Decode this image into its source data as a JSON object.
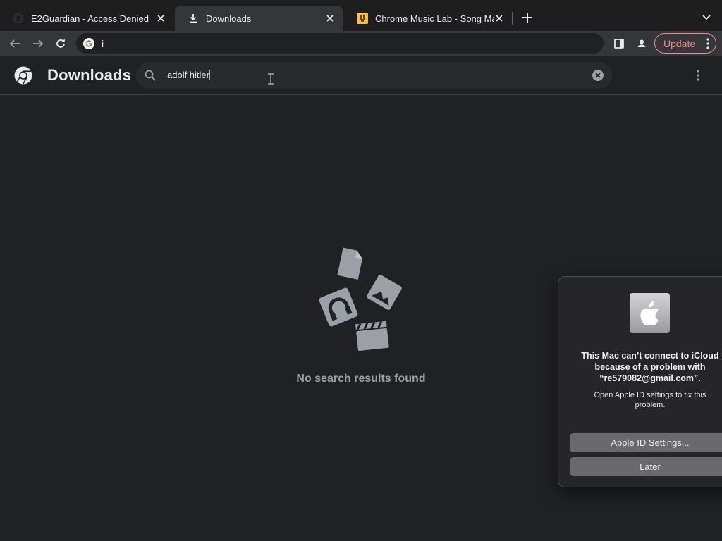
{
  "tabs": [
    {
      "title": "E2Guardian - Access Denied",
      "icon": "github-icon",
      "active": false
    },
    {
      "title": "Downloads",
      "icon": "download-icon",
      "active": true
    },
    {
      "title": "Chrome Music Lab - Song Mak",
      "icon": "song-maker-icon",
      "active": false
    }
  ],
  "toolbar": {
    "omnibox_text": "i",
    "update_label": "Update"
  },
  "downloads": {
    "title": "Downloads",
    "search_query": "adolf hitler",
    "empty_message": "No search results found"
  },
  "dialog": {
    "title": "This Mac can’t connect to iCloud because of a problem with “re579082@gmail.com”.",
    "body": "Open Apple ID settings to fix this problem.",
    "primary_button": "Apple ID Settings...",
    "secondary_button": "Later"
  },
  "colors": {
    "background": "#202124",
    "toolbar": "#35363a",
    "update_accent": "#f28b82",
    "empty_text": "#9aa0a6"
  }
}
